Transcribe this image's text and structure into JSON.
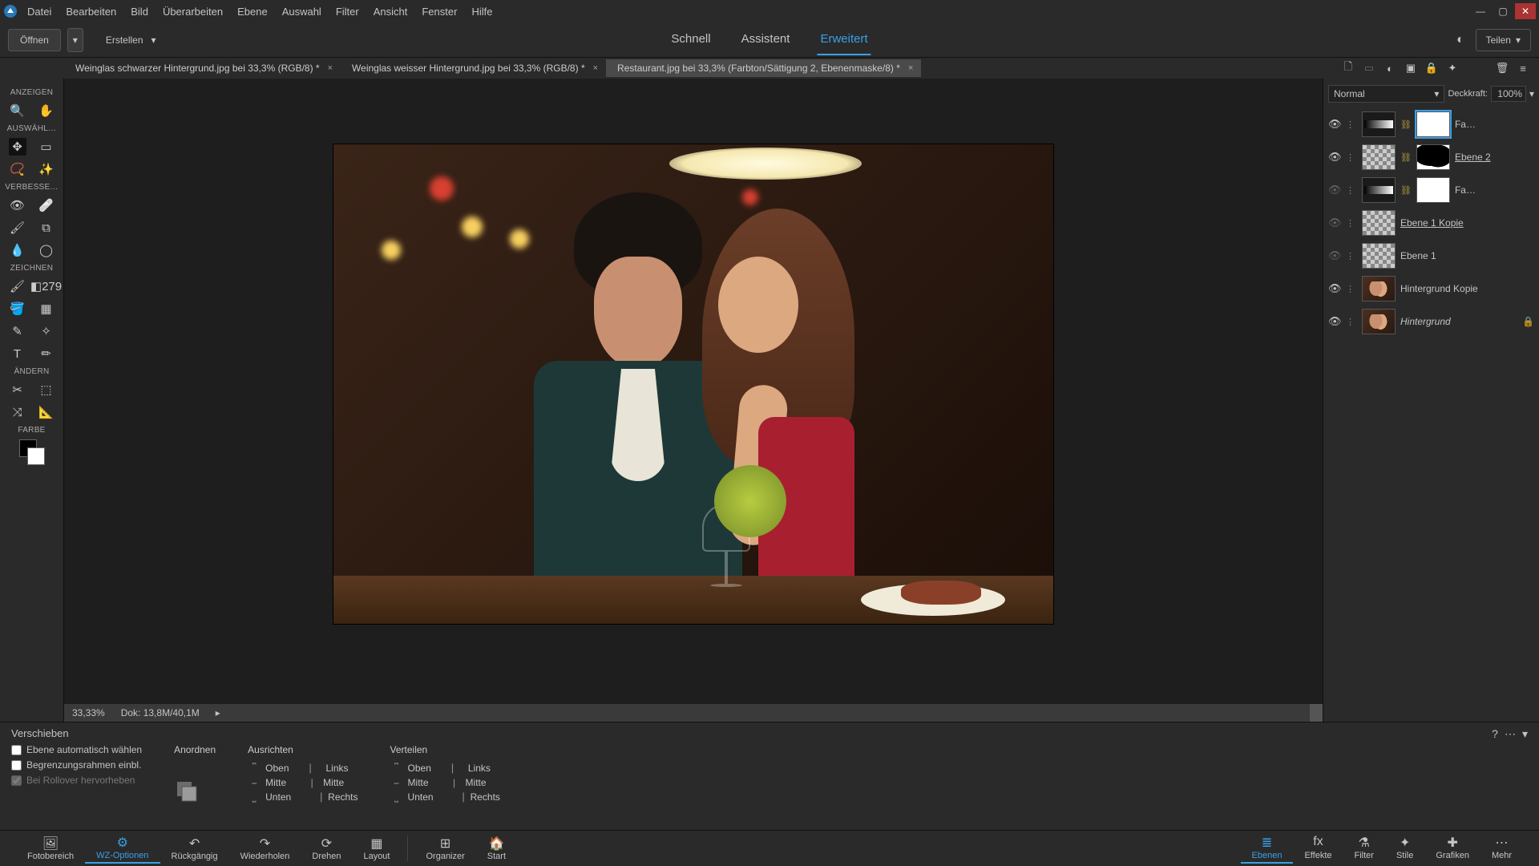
{
  "menu": [
    "Datei",
    "Bearbeiten",
    "Bild",
    "Überarbeiten",
    "Ebene",
    "Auswahl",
    "Filter",
    "Ansicht",
    "Fenster",
    "Hilfe"
  ],
  "topbar": {
    "open": "Öffnen",
    "create": "Erstellen",
    "modes": [
      "Schnell",
      "Assistent",
      "Erweitert"
    ],
    "mode_active": 2,
    "share": "Teilen"
  },
  "doctabs": [
    {
      "label": "Weinglas schwarzer Hintergrund.jpg bei 33,3% (RGB/8) *"
    },
    {
      "label": "Weinglas weisser Hintergrund.jpg bei 33,3% (RGB/8) *"
    },
    {
      "label": "Restaurant.jpg bei 33,3% (Farbton/Sättigung 2, Ebenenmaske/8) *"
    }
  ],
  "doctab_active": 2,
  "tools": {
    "sections": {
      "anzeigen": "ANZEIGEN",
      "auswahl": "AUSWÄHL…",
      "verbesse": "VERBESSE…",
      "zeichnen": "ZEICHNEN",
      "aendern": "ÄNDERN",
      "farbe": "FARBE"
    }
  },
  "status": {
    "zoom": "33,33%",
    "doc": "Dok: 13,8M/40,1M"
  },
  "blend": {
    "mode": "Normal",
    "opacity_label": "Deckkraft:",
    "opacity": "100%"
  },
  "layers": [
    {
      "eye": true,
      "type": "adj-grad",
      "mask": "white-sel",
      "name": "Fa…",
      "link": true,
      "underline": false
    },
    {
      "eye": true,
      "type": "checker",
      "mask": "silhouette",
      "name": "Ebene 2",
      "link": true,
      "underline": true
    },
    {
      "eye": false,
      "type": "adj-grad",
      "mask": "white",
      "name": "Fa…",
      "link": true,
      "underline": false
    },
    {
      "eye": false,
      "type": "checker",
      "mask": null,
      "name": "Ebene 1 Kopie",
      "underline": true
    },
    {
      "eye": false,
      "type": "checker",
      "mask": null,
      "name": "Ebene 1"
    },
    {
      "eye": true,
      "type": "photo",
      "mask": null,
      "name": "Hintergrund Kopie"
    },
    {
      "eye": true,
      "type": "photo",
      "mask": null,
      "name": "Hintergrund",
      "italic": true,
      "locked": true
    }
  ],
  "options": {
    "title": "Verschieben",
    "checks": [
      "Ebene automatisch wählen",
      "Begrenzungsrahmen einbl.",
      "Bei Rollover hervorheben"
    ],
    "anordnen": "Anordnen",
    "ausrichten": {
      "title": "Ausrichten",
      "col1": [
        "Oben",
        "Mitte",
        "Unten"
      ],
      "col2": [
        "Links",
        "Mitte",
        "Rechts"
      ]
    },
    "verteilen": {
      "title": "Verteilen",
      "col1": [
        "Oben",
        "Mitte",
        "Unten"
      ],
      "col2": [
        "Links",
        "Mitte",
        "Rechts"
      ]
    }
  },
  "bottombar": {
    "left": [
      "Fotobereich",
      "WZ-Optionen",
      "Rückgängig",
      "Wiederholen",
      "Drehen",
      "Layout",
      "Organizer",
      "Start"
    ],
    "left_active": 1,
    "right": [
      "Ebenen",
      "Effekte",
      "Filter",
      "Stile",
      "Grafiken",
      "Mehr"
    ],
    "right_active": 0
  }
}
